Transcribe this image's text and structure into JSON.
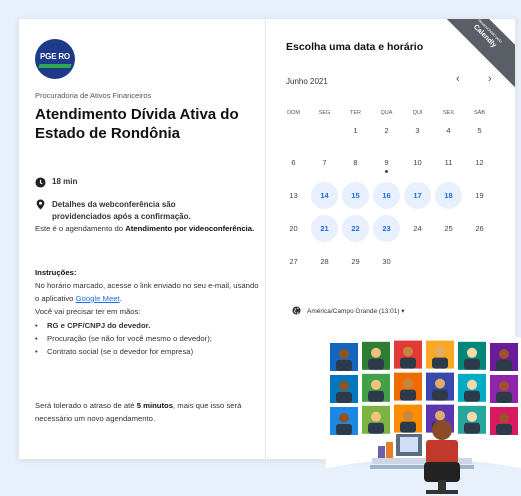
{
  "logo": {
    "text": "PGE RO"
  },
  "event": {
    "organization": "Procuradoria de Ativos Financeiros",
    "title": "Atendimento Dívida Ativa do Estado de Rondônia",
    "duration": "18 min",
    "location": "Detalhes da webconferência são providenciados após a confirmação."
  },
  "description": {
    "intro_pre": "Este é o agendamento do ",
    "intro_bold": "Atendimento por videoconferência.",
    "instructions_label": "Instruções:",
    "instr_pre": "No horário marcado, acesse o link enviado no seu e-mail, usando o aplicativo ",
    "link": "Google Meet",
    "instr_post": ".",
    "instr_2": "Você vai precisar ter em mãos:",
    "bullets": [
      "RG e CPF/CNPJ do devedor.",
      "Procuração (se não for você mesmo o devedor);",
      "Contrato social (se o devedor for empresa)"
    ],
    "tolerance_pre": "Será tolerado o atraso de até ",
    "tolerance_bold": "5 minutos",
    "tolerance_post": ", mais que isso será necessário um novo agendamento."
  },
  "calendar": {
    "heading": "Escolha uma data e horário",
    "badge_small": "desenvolvido pelo",
    "badge_big": "Calendly",
    "month": "Junho 2021",
    "prev": "‹",
    "next": "›",
    "weekdays": [
      "DOM",
      "SEG",
      "TER",
      "QUA",
      "QUI",
      "SEX",
      "SÁB"
    ],
    "weeks": [
      [
        "",
        "",
        "1",
        "2",
        "3",
        "4",
        "5"
      ],
      [
        "6",
        "7",
        "8",
        "9",
        "10",
        "11",
        "12"
      ],
      [
        "13",
        "14",
        "15",
        "16",
        "17",
        "18",
        "19"
      ],
      [
        "20",
        "21",
        "22",
        "23",
        "24",
        "25",
        "26"
      ],
      [
        "27",
        "28",
        "29",
        "30",
        "",
        "",
        ""
      ]
    ],
    "available": [
      "14",
      "15",
      "16",
      "17",
      "18",
      "21",
      "22",
      "23"
    ],
    "today": "9",
    "timezone": "América/Campo Grande (13:01) ▾"
  },
  "colors": {
    "accent": "#1a6fe0",
    "available_bg": "#e8f0fe",
    "logo_bg": "#1e3a8a"
  }
}
